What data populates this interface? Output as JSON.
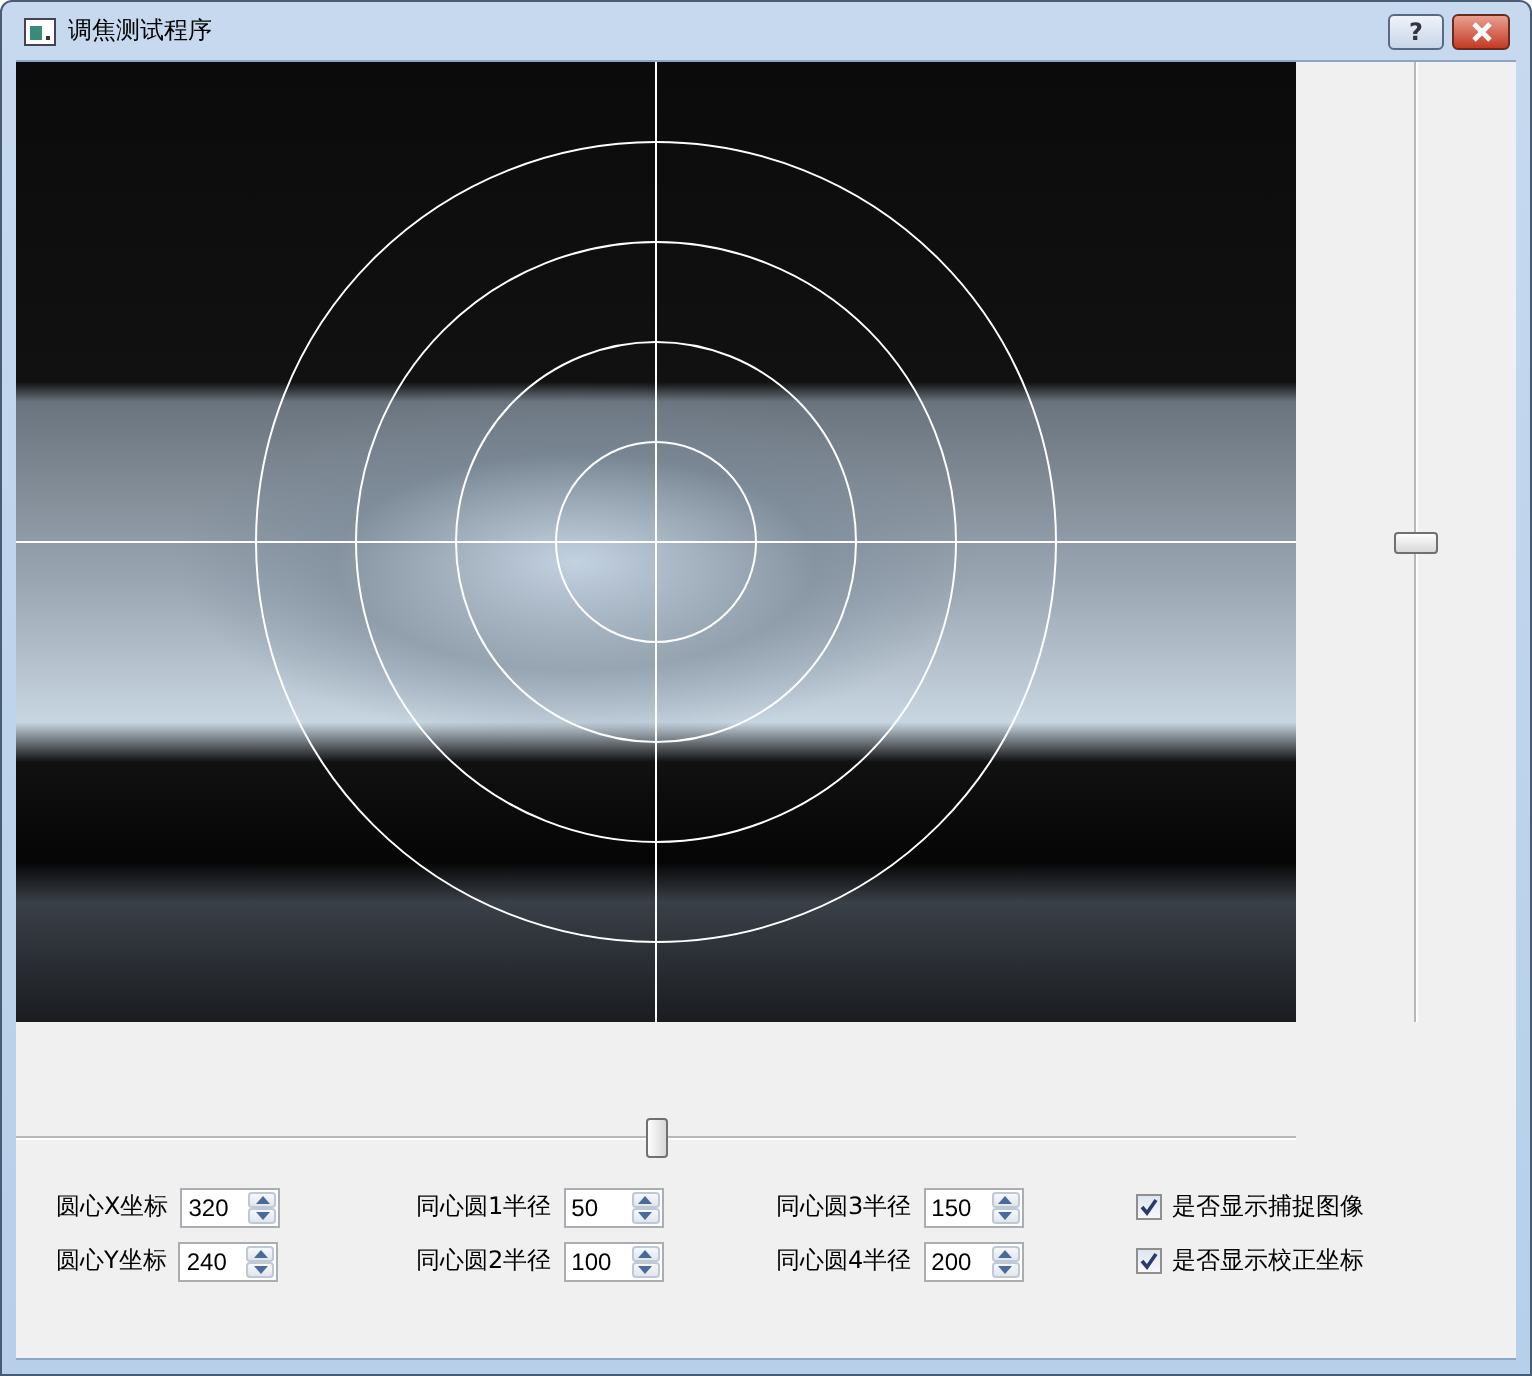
{
  "window": {
    "title": "调焦测试程序",
    "help_button": "?"
  },
  "vertical_slider": {
    "level": 0.5
  },
  "horizontal_slider": {
    "level": 0.5
  },
  "spinboxes": [
    {
      "label": "圆心X坐标",
      "value": "320"
    },
    {
      "label": "圆心Y坐标",
      "value": "240"
    },
    {
      "label": "同心圆1半径",
      "value": "50"
    },
    {
      "label": "同心圆2半径",
      "value": "100"
    },
    {
      "label": "同心圆3半径",
      "value": "150"
    },
    {
      "label": "同心圆4半径",
      "value": "200"
    }
  ],
  "checkboxes": [
    {
      "label": "是否显示捕捉图像",
      "checked": true
    },
    {
      "label": "是否显示校正坐标",
      "checked": true
    }
  ]
}
